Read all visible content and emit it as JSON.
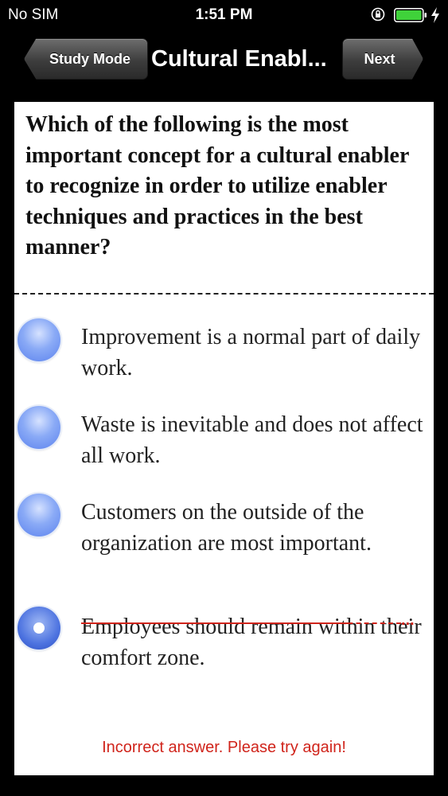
{
  "status_bar": {
    "carrier": "No SIM",
    "time": "1:51 PM",
    "icons": [
      "orientation-lock-icon",
      "battery-icon",
      "charging-bolt-icon"
    ]
  },
  "nav": {
    "back_label": "Study Mode",
    "title": "Cultural Enabl...",
    "next_label": "Next"
  },
  "question": {
    "text": "Which of the following is the most important concept for a cultural enabler to recognize in order to utilize enabler techniques and practices in the best manner?"
  },
  "options": [
    {
      "label": "Improvement is a normal part of daily work.",
      "selected": false
    },
    {
      "label": "Waste is inevitable and does not affect all work.",
      "selected": false
    },
    {
      "label": "Customers on the outside of the organization are most important.",
      "selected": false
    },
    {
      "label": "Employees should remain within their comfort zone.",
      "selected": true,
      "struck": true,
      "ellipsis": "..."
    }
  ],
  "feedback": "Incorrect answer. Please try again!",
  "colors": {
    "error": "#d0241b",
    "radio": "#5b82ee"
  }
}
